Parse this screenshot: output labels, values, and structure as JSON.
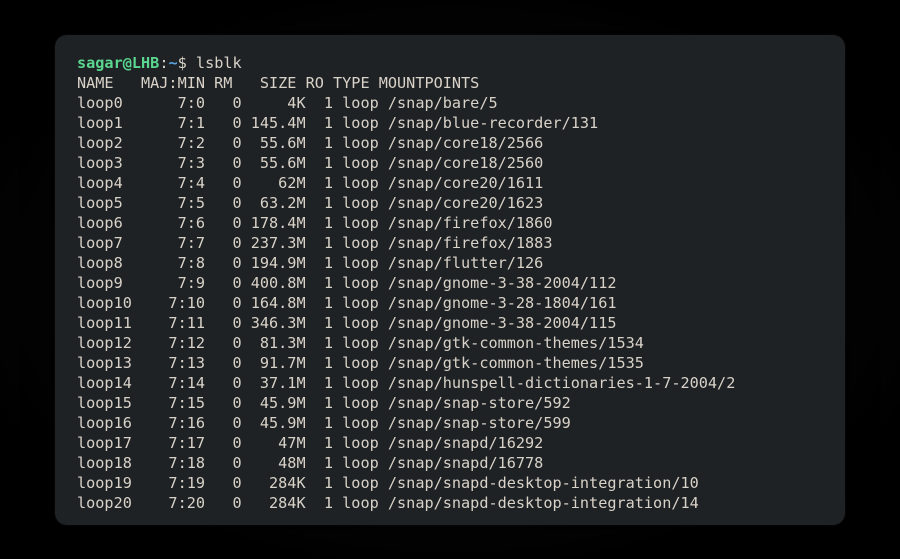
{
  "prompt": {
    "user": "sagar",
    "at": "@",
    "host": "LHB",
    "colon": ":",
    "path": "~",
    "dollar": "$ ",
    "command": "lsblk"
  },
  "headers": {
    "name": "NAME",
    "majmin": "MAJ:MIN",
    "rm": "RM",
    "size": "SIZE",
    "ro": "RO",
    "type": "TYPE",
    "mount": "MOUNTPOINTS"
  },
  "rows": [
    {
      "name": "loop0",
      "majmin": "7:0",
      "rm": "0",
      "size": "4K",
      "ro": "1",
      "type": "loop",
      "mount": "/snap/bare/5"
    },
    {
      "name": "loop1",
      "majmin": "7:1",
      "rm": "0",
      "size": "145.4M",
      "ro": "1",
      "type": "loop",
      "mount": "/snap/blue-recorder/131"
    },
    {
      "name": "loop2",
      "majmin": "7:2",
      "rm": "0",
      "size": "55.6M",
      "ro": "1",
      "type": "loop",
      "mount": "/snap/core18/2566"
    },
    {
      "name": "loop3",
      "majmin": "7:3",
      "rm": "0",
      "size": "55.6M",
      "ro": "1",
      "type": "loop",
      "mount": "/snap/core18/2560"
    },
    {
      "name": "loop4",
      "majmin": "7:4",
      "rm": "0",
      "size": "62M",
      "ro": "1",
      "type": "loop",
      "mount": "/snap/core20/1611"
    },
    {
      "name": "loop5",
      "majmin": "7:5",
      "rm": "0",
      "size": "63.2M",
      "ro": "1",
      "type": "loop",
      "mount": "/snap/core20/1623"
    },
    {
      "name": "loop6",
      "majmin": "7:6",
      "rm": "0",
      "size": "178.4M",
      "ro": "1",
      "type": "loop",
      "mount": "/snap/firefox/1860"
    },
    {
      "name": "loop7",
      "majmin": "7:7",
      "rm": "0",
      "size": "237.3M",
      "ro": "1",
      "type": "loop",
      "mount": "/snap/firefox/1883"
    },
    {
      "name": "loop8",
      "majmin": "7:8",
      "rm": "0",
      "size": "194.9M",
      "ro": "1",
      "type": "loop",
      "mount": "/snap/flutter/126"
    },
    {
      "name": "loop9",
      "majmin": "7:9",
      "rm": "0",
      "size": "400.8M",
      "ro": "1",
      "type": "loop",
      "mount": "/snap/gnome-3-38-2004/112"
    },
    {
      "name": "loop10",
      "majmin": "7:10",
      "rm": "0",
      "size": "164.8M",
      "ro": "1",
      "type": "loop",
      "mount": "/snap/gnome-3-28-1804/161"
    },
    {
      "name": "loop11",
      "majmin": "7:11",
      "rm": "0",
      "size": "346.3M",
      "ro": "1",
      "type": "loop",
      "mount": "/snap/gnome-3-38-2004/115"
    },
    {
      "name": "loop12",
      "majmin": "7:12",
      "rm": "0",
      "size": "81.3M",
      "ro": "1",
      "type": "loop",
      "mount": "/snap/gtk-common-themes/1534"
    },
    {
      "name": "loop13",
      "majmin": "7:13",
      "rm": "0",
      "size": "91.7M",
      "ro": "1",
      "type": "loop",
      "mount": "/snap/gtk-common-themes/1535"
    },
    {
      "name": "loop14",
      "majmin": "7:14",
      "rm": "0",
      "size": "37.1M",
      "ro": "1",
      "type": "loop",
      "mount": "/snap/hunspell-dictionaries-1-7-2004/2"
    },
    {
      "name": "loop15",
      "majmin": "7:15",
      "rm": "0",
      "size": "45.9M",
      "ro": "1",
      "type": "loop",
      "mount": "/snap/snap-store/592"
    },
    {
      "name": "loop16",
      "majmin": "7:16",
      "rm": "0",
      "size": "45.9M",
      "ro": "1",
      "type": "loop",
      "mount": "/snap/snap-store/599"
    },
    {
      "name": "loop17",
      "majmin": "7:17",
      "rm": "0",
      "size": "47M",
      "ro": "1",
      "type": "loop",
      "mount": "/snap/snapd/16292"
    },
    {
      "name": "loop18",
      "majmin": "7:18",
      "rm": "0",
      "size": "48M",
      "ro": "1",
      "type": "loop",
      "mount": "/snap/snapd/16778"
    },
    {
      "name": "loop19",
      "majmin": "7:19",
      "rm": "0",
      "size": "284K",
      "ro": "1",
      "type": "loop",
      "mount": "/snap/snapd-desktop-integration/10"
    },
    {
      "name": "loop20",
      "majmin": "7:20",
      "rm": "0",
      "size": "284K",
      "ro": "1",
      "type": "loop",
      "mount": "/snap/snapd-desktop-integration/14"
    }
  ]
}
